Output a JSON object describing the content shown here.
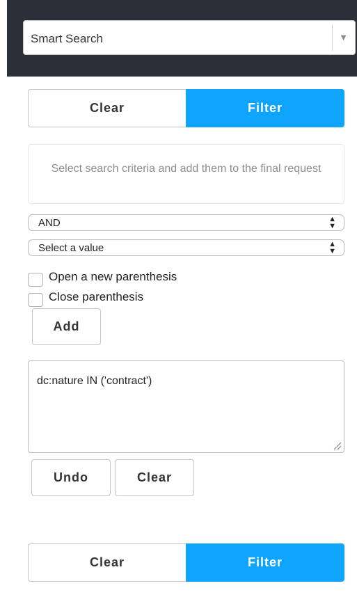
{
  "header": {
    "search_select": {
      "label": "Smart Search",
      "caret": "▼"
    }
  },
  "top_actions": {
    "clear_label": "Clear",
    "filter_label": "Filter"
  },
  "info": {
    "text": "Select search criteria and add them to the final request"
  },
  "operator_select": {
    "value": "AND",
    "arrows": "▴▾"
  },
  "value_select": {
    "value": "Select a value",
    "arrows": "▴▾"
  },
  "checkboxes": {
    "open_paren": {
      "label": "Open a new parenthesis",
      "checked": false
    },
    "close_paren": {
      "label": "Close parenthesis",
      "checked": false
    }
  },
  "add_label": "Add",
  "query": {
    "text": "dc:nature IN ('contract')"
  },
  "query_actions": {
    "undo_label": "Undo",
    "clear_label": "Clear"
  },
  "bottom_actions": {
    "clear_label": "Clear",
    "filter_label": "Filter"
  },
  "colors": {
    "accent": "#0fa5ff",
    "header_bg": "#2a2f38"
  },
  "icons": {
    "select_caret": "chevron-down-icon",
    "select_arrows": "up-down-arrows-icon",
    "textarea_grip": "resize-grip-icon"
  }
}
